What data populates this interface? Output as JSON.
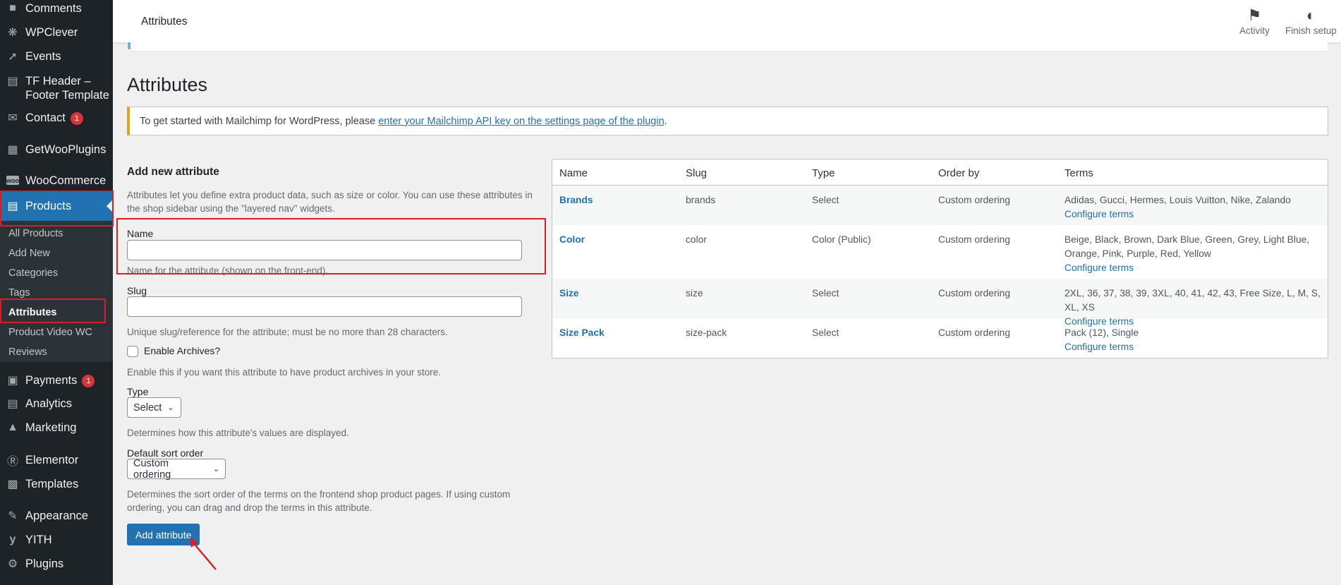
{
  "sidebar": {
    "items": [
      {
        "label": "Comments",
        "icon": "comment-icon"
      },
      {
        "label": "WPClever",
        "icon": "bulb-icon"
      },
      {
        "label": "Events",
        "icon": "pin-icon"
      },
      {
        "label": "TF Header –",
        "label2": "Footer Template",
        "icon": "page-icon"
      },
      {
        "label": "Contact",
        "badge": "1",
        "icon": "mail-icon"
      },
      {
        "label": "GetWooPlugins",
        "icon": "plugins-grid-icon"
      },
      {
        "label": "WooCommerce",
        "icon": "woo-icon"
      },
      {
        "label": "Products",
        "icon": "archive-icon"
      },
      {
        "label": "Payments",
        "badge": "1",
        "icon": "dollar-icon"
      },
      {
        "label": "Analytics",
        "icon": "bar-chart-icon"
      },
      {
        "label": "Marketing",
        "icon": "megaphone-icon"
      },
      {
        "label": "Elementor",
        "icon": "elementor-icon"
      },
      {
        "label": "Templates",
        "icon": "folder-icon"
      },
      {
        "label": "Appearance",
        "icon": "brush-icon"
      },
      {
        "label": "YITH",
        "icon": "yith-icon"
      },
      {
        "label": "Plugins",
        "icon": "plug-icon"
      }
    ],
    "submenu": [
      "All Products",
      "Add New",
      "Categories",
      "Tags",
      "Attributes",
      "Product Video WC",
      "Reviews"
    ]
  },
  "topbar": {
    "title": "Attributes",
    "activity": "Activity",
    "finish_setup": "Finish setup"
  },
  "page": {
    "title": "Attributes",
    "notice_text": "To get started with Mailchimp for WordPress, please ",
    "notice_link": "enter your Mailchimp API key on the settings page of the plugin",
    "notice_end": "."
  },
  "form": {
    "heading": "Add new attribute",
    "intro": "Attributes let you define extra product data, such as size or color. You can use these attributes in the shop sidebar using the \"layered nav\" widgets.",
    "name_label": "Name",
    "name_value": "",
    "name_help": "Name for the attribute (shown on the front-end).",
    "slug_label": "Slug",
    "slug_value": "",
    "slug_help": "Unique slug/reference for the attribute; must be no more than 28 characters.",
    "archives_label": "Enable Archives?",
    "archives_checked": false,
    "archives_help": "Enable this if you want this attribute to have product archives in your store.",
    "type_label": "Type",
    "type_value": "Select",
    "type_help": "Determines how this attribute's values are displayed.",
    "sort_label": "Default sort order",
    "sort_value": "Custom ordering",
    "sort_help": "Determines the sort order of the terms on the frontend shop product pages. If using custom ordering, you can drag and drop the terms in this attribute.",
    "submit": "Add attribute"
  },
  "table": {
    "headers": [
      "Name",
      "Slug",
      "Type",
      "Order by",
      "Terms"
    ],
    "rows": [
      {
        "name": "Brands",
        "slug": "brands",
        "type": "Select",
        "order": "Custom ordering",
        "terms": "Adidas, Gucci, Hermes, Louis Vuitton, Nike, Zalando",
        "configure": "Configure terms"
      },
      {
        "name": "Color",
        "slug": "color",
        "type": "Color (Public)",
        "order": "Custom ordering",
        "terms": "Beige, Black, Brown, Dark Blue, Green, Grey, Light Blue, Orange, Pink, Purple, Red, Yellow",
        "configure": "Configure terms"
      },
      {
        "name": "Size",
        "slug": "size",
        "type": "Select",
        "order": "Custom ordering",
        "terms": "2XL, 36, 37, 38, 39, 3XL, 40, 41, 42, 43, Free Size, L, M, S, XL, XS",
        "configure": "Configure terms"
      },
      {
        "name": "Size Pack",
        "slug": "size-pack",
        "type": "Select",
        "order": "Custom ordering",
        "terms": "Pack (12), Single",
        "configure": "Configure terms"
      }
    ]
  },
  "colors": {
    "accent": "#2271b1",
    "sidebar": "#1d2327",
    "annotation": "#d61f26"
  }
}
